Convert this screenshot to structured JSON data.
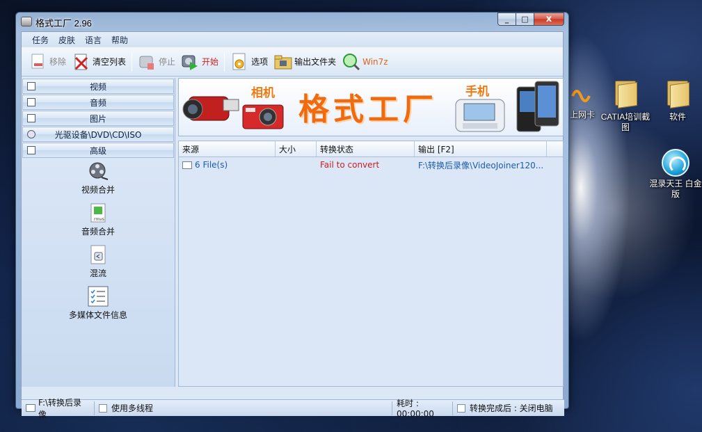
{
  "window": {
    "title": "格式工厂 2.96",
    "controls": {
      "minimize": "_",
      "maximize": "□",
      "close": "x"
    }
  },
  "menu": [
    "任务",
    "皮肤",
    "语言",
    "帮助"
  ],
  "toolbar": {
    "remove": "移除",
    "clear_list": "清空列表",
    "stop": "停止",
    "start": "开始",
    "options": "选项",
    "output_folder": "输出文件夹",
    "win7z": "Win7z"
  },
  "sidebar": {
    "categories": [
      "视频",
      "音频",
      "图片",
      "光驱设备\\DVD\\CD\\ISO",
      "高级"
    ],
    "tools": [
      "视频合并",
      "音频合并",
      "混流",
      "多媒体文件信息"
    ]
  },
  "banner": {
    "camera_label": "相机",
    "title": "格式工厂",
    "phone_label": "手机"
  },
  "table": {
    "columns": [
      "来源",
      "大小",
      "转换状态",
      "输出 [F2]"
    ],
    "rows": [
      {
        "source": "6 File(s)",
        "size": "",
        "status": "Fail to convert",
        "output": "F:\\转换后录像\\VideoJoiner120..."
      }
    ]
  },
  "statusbar": {
    "output_path": "F:\\转换后录像",
    "multithread": "使用多线程",
    "elapsed": "耗时 : 00:00:00",
    "after_convert": "转换完成后 : 关闭电脑"
  },
  "desktop": {
    "icons": [
      "上网卡",
      "CATIA培训截图",
      "软件",
      "混录天王 白金版"
    ]
  },
  "colors": {
    "banner_orange": "#f06a10",
    "status_fail": "#c81f1f",
    "path_blue": "#1c5bb0"
  }
}
